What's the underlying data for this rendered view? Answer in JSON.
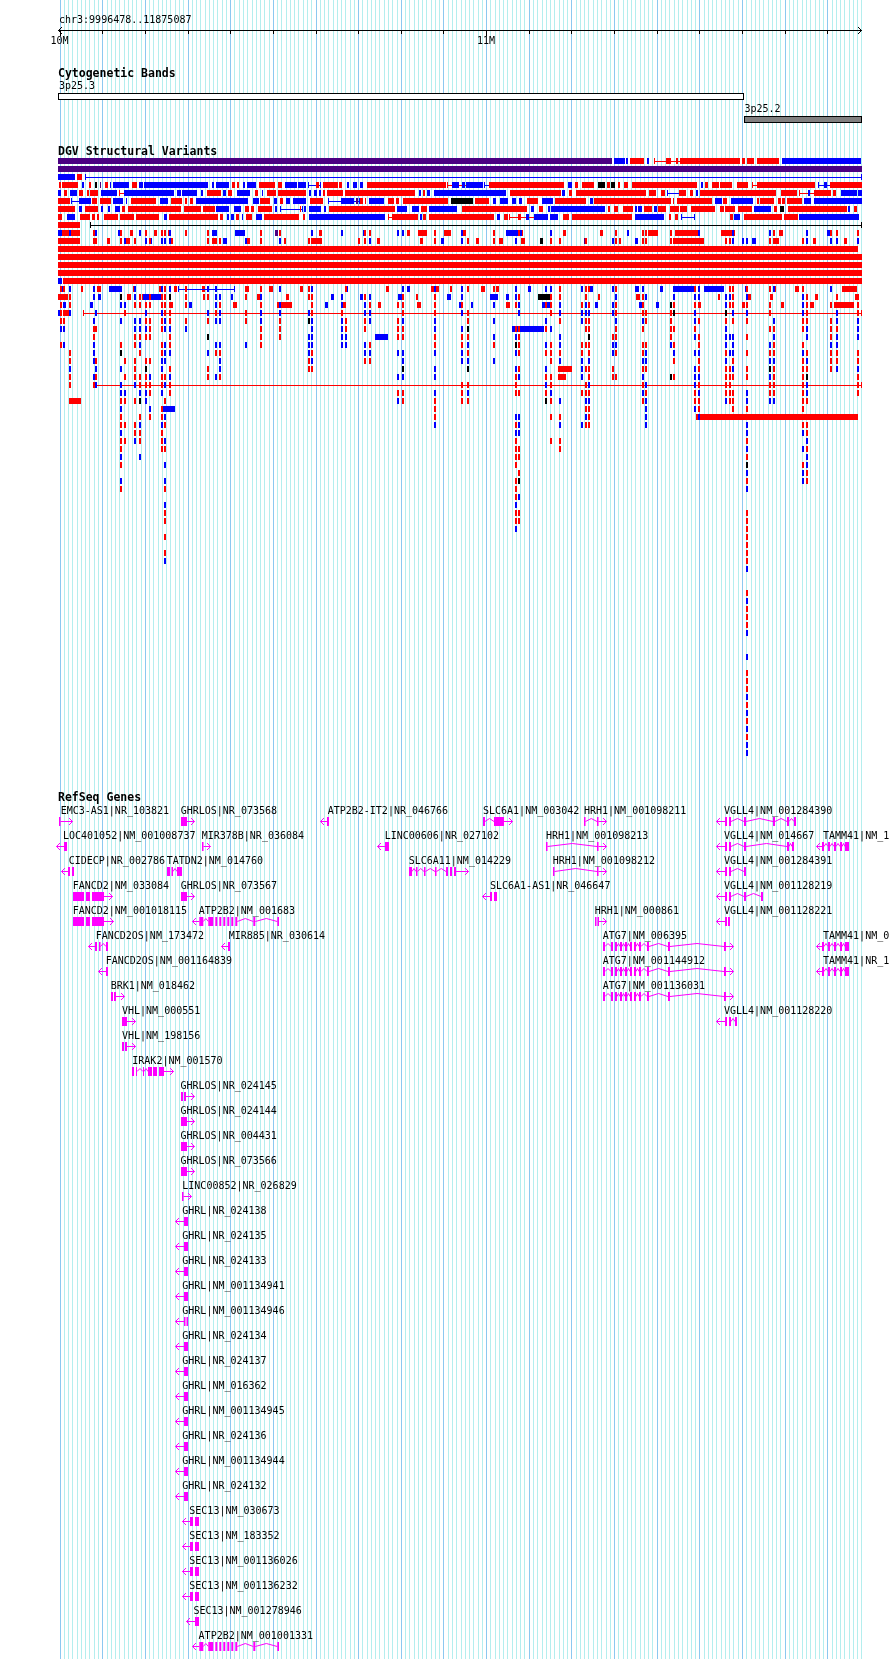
{
  "location": {
    "label": "chr3:9996478..11875087"
  },
  "ruler": {
    "ticks": [
      "10M",
      "11M"
    ]
  },
  "cytogenetic_bands": {
    "title": "Cytogenetic Bands",
    "bands": [
      {
        "name": "3p25.3",
        "color": "#ffffff"
      },
      {
        "name": "3p25.2",
        "color": "#808080"
      }
    ]
  },
  "dgv_structural_variants": {
    "title": "DGV Structural Variants"
  },
  "refseq_genes": {
    "title": "RefSeq Genes",
    "rows": [
      {
        "genes": [
          {
            "label": "EMC3-AS1|NR_103821",
            "reverse_strand": false
          },
          {
            "label": "GHRLOS|NR_073568",
            "reverse_strand": false
          },
          {
            "label": "ATP2B2-IT2|NR_046766",
            "reverse_strand": true
          },
          {
            "label": "SLC6A1|NM_003042",
            "reverse_strand": false
          },
          {
            "label": "HRH1|NM_001098211",
            "reverse_strand": false
          },
          {
            "label": "VGLL4|NM_001284390",
            "reverse_strand": true
          }
        ]
      },
      {
        "genes": [
          {
            "label": "LOC401052|NM_001008737",
            "reverse_strand": true
          },
          {
            "label": "MIR378B|NR_036084",
            "reverse_strand": false
          },
          {
            "label": "LINC00606|NR_027102",
            "reverse_strand": true
          },
          {
            "label": "HRH1|NM_001098213",
            "reverse_strand": false
          },
          {
            "label": "VGLL4|NM_014667",
            "reverse_strand": true
          },
          {
            "label": "TAMM41|NM_1",
            "reverse_strand": true
          }
        ]
      },
      {
        "genes": [
          {
            "label": "CIDECP|NR_002786",
            "reverse_strand": true
          },
          {
            "label": "TATDN2|NM_014760"
          },
          {
            "label": "SLC6A11|NM_014229",
            "reverse_strand": false
          },
          {
            "label": "HRH1|NM_001098212",
            "reverse_strand": false
          },
          {
            "label": "VGLL4|NM_001284391",
            "reverse_strand": true
          }
        ]
      },
      {
        "genes": [
          {
            "label": "FANCD2|NM_033084",
            "reverse_strand": false
          },
          {
            "label": "GHRLOS|NR_073567",
            "reverse_strand": false
          },
          {
            "label": "SLC6A1-AS1|NR_046647",
            "reverse_strand": true
          },
          {
            "label": "VGLL4|NM_001128219",
            "reverse_strand": true
          }
        ]
      },
      {
        "genes": [
          {
            "label": "FANCD2|NM_001018115",
            "reverse_strand": false
          },
          {
            "label": "ATP2B2|NM_001683",
            "reverse_strand": true
          },
          {
            "label": "HRH1|NM_000861",
            "reverse_strand": false
          },
          {
            "label": "VGLL4|NM_001128221",
            "reverse_strand": true
          }
        ]
      },
      {
        "genes": [
          {
            "label": "FANCD2OS|NM_173472",
            "reverse_strand": true
          },
          {
            "label": "MIR885|NR_030614",
            "reverse_strand": true
          },
          {
            "label": "ATG7|NM_006395",
            "reverse_strand": false
          },
          {
            "label": "TAMM41|NM_0",
            "reverse_strand": true
          }
        ]
      },
      {
        "genes": [
          {
            "label": "FANCD2OS|NM_001164839",
            "reverse_strand": true
          },
          {
            "label": "ATG7|NM_001144912",
            "reverse_strand": false
          },
          {
            "label": "TAMM41|NR_1",
            "reverse_strand": true
          }
        ]
      },
      {
        "genes": [
          {
            "label": "BRK1|NM_018462",
            "reverse_strand": false
          },
          {
            "label": "ATG7|NM_001136031",
            "reverse_strand": false
          }
        ]
      },
      {
        "genes": [
          {
            "label": "VHL|NM_000551",
            "reverse_strand": false
          },
          {
            "label": "VGLL4|NM_001128220",
            "reverse_strand": true
          }
        ]
      },
      {
        "genes": [
          {
            "label": "VHL|NM_198156",
            "reverse_strand": false
          }
        ]
      },
      {
        "genes": [
          {
            "label": "IRAK2|NM_001570",
            "reverse_strand": false
          }
        ]
      },
      {
        "genes": [
          {
            "label": "GHRLOS|NR_024145",
            "reverse_strand": false
          }
        ]
      },
      {
        "genes": [
          {
            "label": "GHRLOS|NR_024144",
            "reverse_strand": false
          }
        ]
      },
      {
        "genes": [
          {
            "label": "GHRLOS|NR_004431",
            "reverse_strand": false
          }
        ]
      },
      {
        "genes": [
          {
            "label": "GHRLOS|NR_073566",
            "reverse_strand": false
          }
        ]
      },
      {
        "genes": [
          {
            "label": "LINC00852|NR_026829",
            "reverse_strand": false
          }
        ]
      },
      {
        "genes": [
          {
            "label": "GHRL|NR_024138",
            "reverse_strand": true
          }
        ]
      },
      {
        "genes": [
          {
            "label": "GHRL|NR_024135",
            "reverse_strand": true
          }
        ]
      },
      {
        "genes": [
          {
            "label": "GHRL|NR_024133",
            "reverse_strand": true
          }
        ]
      },
      {
        "genes": [
          {
            "label": "GHRL|NM_001134941",
            "reverse_strand": true
          }
        ]
      },
      {
        "genes": [
          {
            "label": "GHRL|NM_001134946",
            "reverse_strand": true
          }
        ]
      },
      {
        "genes": [
          {
            "label": "GHRL|NR_024134",
            "reverse_strand": true
          }
        ]
      },
      {
        "genes": [
          {
            "label": "GHRL|NR_024137",
            "reverse_strand": true
          }
        ]
      },
      {
        "genes": [
          {
            "label": "GHRL|NM_016362",
            "reverse_strand": true
          }
        ]
      },
      {
        "genes": [
          {
            "label": "GHRL|NM_001134945",
            "reverse_strand": true
          }
        ]
      },
      {
        "genes": [
          {
            "label": "GHRL|NR_024136",
            "reverse_strand": true
          }
        ]
      },
      {
        "genes": [
          {
            "label": "GHRL|NM_001134944",
            "reverse_strand": true
          }
        ]
      },
      {
        "genes": [
          {
            "label": "GHRL|NR_024132",
            "reverse_strand": true
          }
        ]
      },
      {
        "genes": [
          {
            "label": "SEC13|NM_030673",
            "reverse_strand": true
          }
        ]
      },
      {
        "genes": [
          {
            "label": "SEC13|NM_183352",
            "reverse_strand": true
          }
        ]
      },
      {
        "genes": [
          {
            "label": "SEC13|NM_001136026",
            "reverse_strand": true
          }
        ]
      },
      {
        "genes": [
          {
            "label": "SEC13|NM_001136232",
            "reverse_strand": true
          }
        ]
      },
      {
        "genes": [
          {
            "label": "SEC13|NM_001278946",
            "reverse_strand": true
          }
        ]
      },
      {
        "genes": [
          {
            "label": "ATP2B2|NM_001001331",
            "reverse_strand": true
          }
        ]
      }
    ]
  }
}
